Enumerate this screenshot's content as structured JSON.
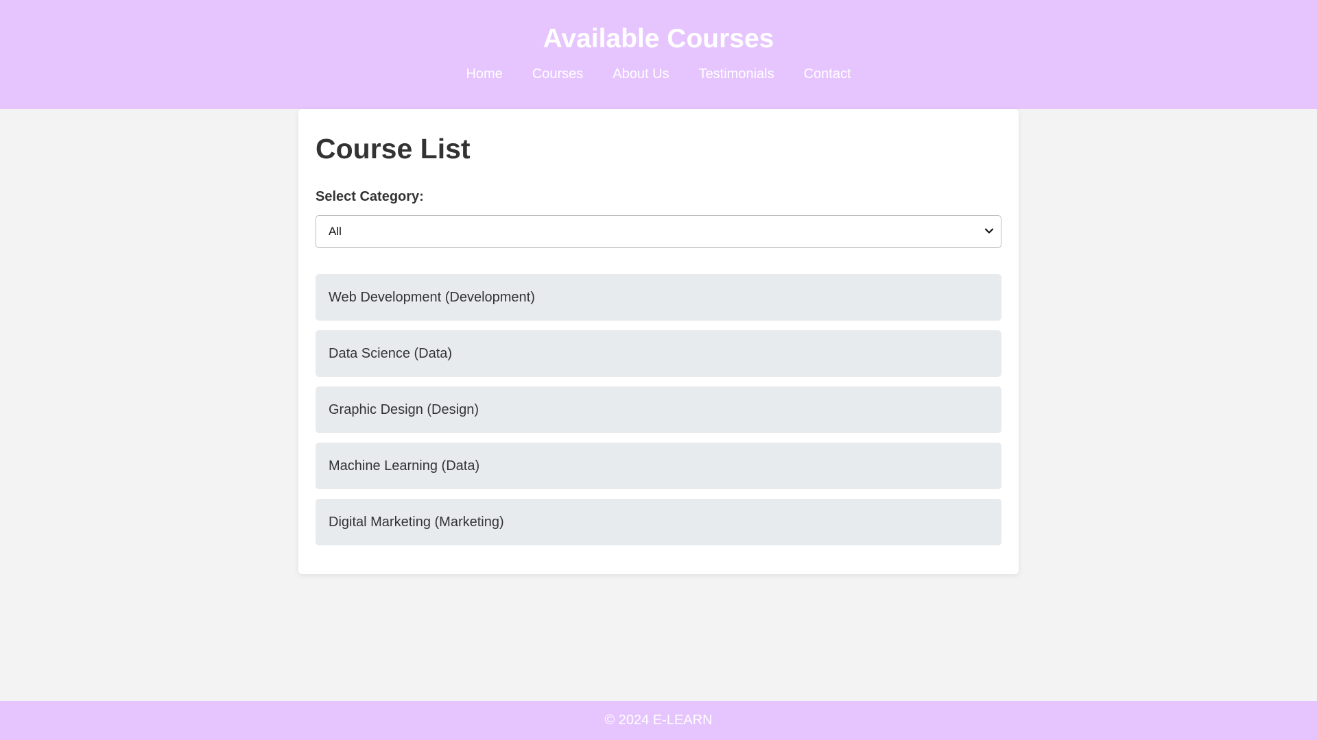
{
  "header": {
    "title": "Available Courses",
    "nav": [
      "Home",
      "Courses",
      "About Us",
      "Testimonials",
      "Contact"
    ]
  },
  "main": {
    "heading": "Course List",
    "category_label": "Select Category:",
    "category_select": {
      "selected": "All",
      "icon": "chevron-down-icon"
    },
    "courses": [
      "Web Development (Development)",
      "Data Science (Data)",
      "Graphic Design (Design)",
      "Machine Learning (Data)",
      "Digital Marketing (Marketing)"
    ]
  },
  "footer": {
    "text": "© 2024 E-LEARN"
  },
  "colors": {
    "header_bg": "#e6c5ff",
    "page_bg": "#f3f3f3",
    "card_bg": "#ffffff",
    "item_bg": "#e8ebee",
    "text": "#333333"
  }
}
